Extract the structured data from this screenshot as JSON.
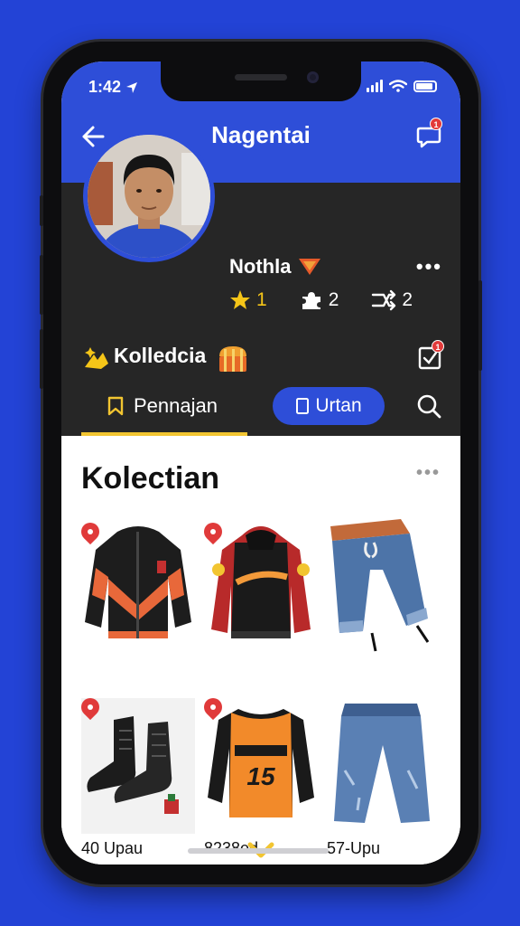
{
  "status": {
    "time": "1:42"
  },
  "header": {
    "title": "Nagentai",
    "message_badge": "1"
  },
  "profile": {
    "name": "Nothla",
    "stats": [
      {
        "icon": "star-icon",
        "value": "1"
      },
      {
        "icon": "puzzle-icon",
        "value": "2"
      },
      {
        "icon": "share-icon",
        "value": "2"
      }
    ]
  },
  "collection": {
    "title": "Kolledcia",
    "badge": "1"
  },
  "tabs": {
    "active": "Pennajan",
    "secondary": "Urtan"
  },
  "section": {
    "title": "Kolectian"
  },
  "prices": [
    "40 Upau",
    "8238ed",
    "57-Upu"
  ],
  "colors": {
    "accent": "#2e4ed8",
    "dark": "#262626",
    "highlight": "#f2c531",
    "badge": "#e23a3a"
  }
}
